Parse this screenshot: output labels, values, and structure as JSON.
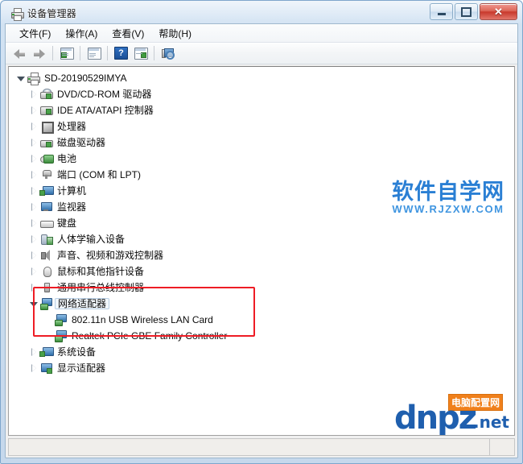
{
  "window": {
    "title": "设备管理器",
    "title_icon": "printer-device-icon",
    "controls": {
      "minimize": "—",
      "maximize": "□",
      "close": "✕"
    }
  },
  "menubar": {
    "items": [
      {
        "label": "文件(F)"
      },
      {
        "label": "操作(A)"
      },
      {
        "label": "查看(V)"
      },
      {
        "label": "帮助(H)"
      }
    ]
  },
  "toolbar": {
    "buttons": [
      {
        "name": "back-arrow-icon"
      },
      {
        "name": "forward-arrow-icon"
      },
      {
        "name": "properties-icon"
      },
      {
        "name": "update-driver-icon"
      },
      {
        "name": "help-icon",
        "glyph": "?"
      },
      {
        "name": "show-hidden-devices-icon"
      },
      {
        "name": "scan-hardware-changes-icon"
      }
    ]
  },
  "tree": {
    "root": {
      "label": "SD-20190529IMYA",
      "icon": "computer-printer-icon",
      "expanded": true
    },
    "items": [
      {
        "label": "DVD/CD-ROM 驱动器",
        "icon": "dvd-drive-icon",
        "expanded": false,
        "level": 1
      },
      {
        "label": "IDE ATA/ATAPI 控制器",
        "icon": "ide-controller-icon",
        "expanded": false,
        "level": 1
      },
      {
        "label": "处理器",
        "icon": "processor-icon",
        "expanded": false,
        "level": 1
      },
      {
        "label": "磁盘驱动器",
        "icon": "disk-drive-icon",
        "expanded": false,
        "level": 1
      },
      {
        "label": "电池",
        "icon": "battery-icon",
        "expanded": false,
        "level": 1
      },
      {
        "label": "端口 (COM 和 LPT)",
        "icon": "port-icon",
        "expanded": false,
        "level": 1
      },
      {
        "label": "计算机",
        "icon": "computer-icon",
        "expanded": false,
        "level": 1
      },
      {
        "label": "监视器",
        "icon": "monitor-icon",
        "expanded": false,
        "level": 1
      },
      {
        "label": "键盘",
        "icon": "keyboard-icon",
        "expanded": false,
        "level": 1
      },
      {
        "label": "人体学输入设备",
        "icon": "hid-icon",
        "expanded": false,
        "level": 1
      },
      {
        "label": "声音、视频和游戏控制器",
        "icon": "sound-video-game-icon",
        "expanded": false,
        "level": 1
      },
      {
        "label": "鼠标和其他指针设备",
        "icon": "mouse-icon",
        "expanded": false,
        "level": 1
      },
      {
        "label": "通用串行总线控制器",
        "icon": "usb-controller-icon",
        "expanded": false,
        "level": 1
      },
      {
        "label": "网络适配器",
        "icon": "network-adapter-icon",
        "expanded": true,
        "level": 1,
        "selected": true
      },
      {
        "label": "802.11n USB Wireless LAN Card",
        "icon": "network-device-icon",
        "level": 2
      },
      {
        "label": "Realtek PCIe GBE Family Controller",
        "icon": "network-device-icon",
        "level": 2
      },
      {
        "label": "系统设备",
        "icon": "system-device-icon",
        "expanded": false,
        "level": 1
      },
      {
        "label": "显示适配器",
        "icon": "display-adapter-icon",
        "expanded": false,
        "level": 1
      }
    ]
  },
  "annotation": {
    "name": "red-highlight-box",
    "color": "#ee1c25",
    "target": "网络适配器"
  },
  "statusbar": {
    "text": ""
  },
  "watermarks": {
    "primary": {
      "title": "软件自学网",
      "url": "WWW.RJZXW.COM",
      "color": "#2a7fd4"
    },
    "secondary": {
      "text": "dnpz",
      "suffix": ".net",
      "badge": "电脑配置网",
      "badge_color": "#f0801b",
      "color": "#1f5fae"
    }
  }
}
